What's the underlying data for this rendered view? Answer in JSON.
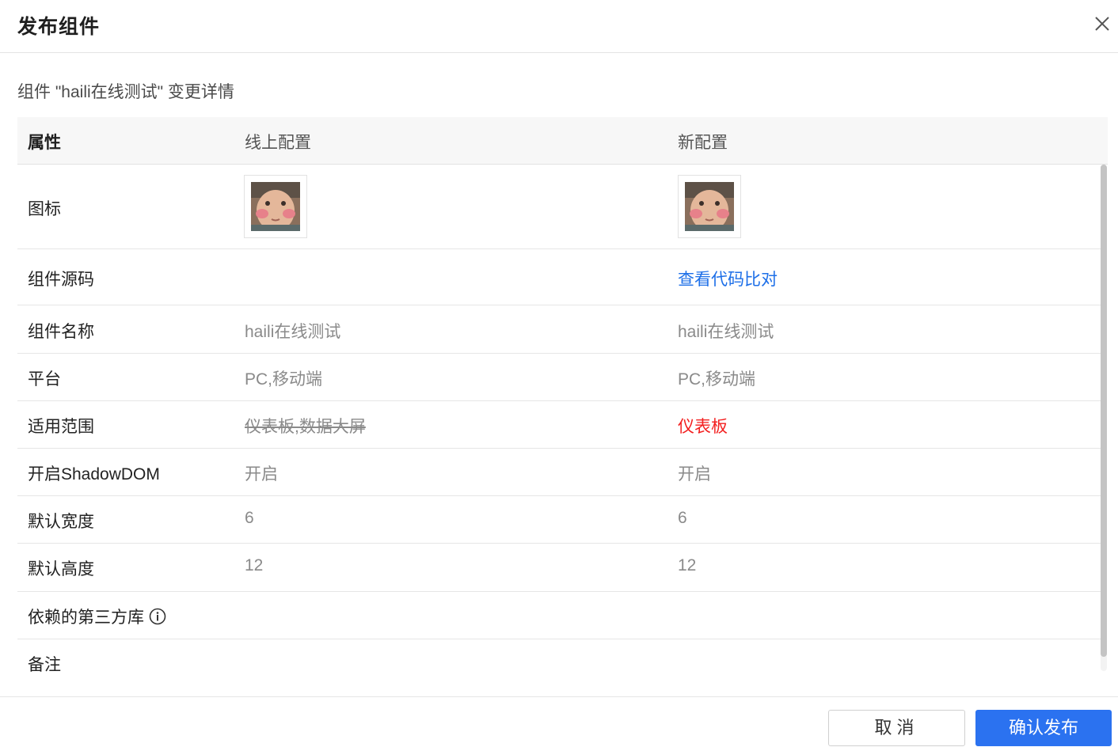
{
  "dialog": {
    "title": "发布组件",
    "subtitle": "组件 \"haili在线测试\" 变更详情"
  },
  "table": {
    "headers": {
      "attr": "属性",
      "online": "线上配置",
      "new": "新配置"
    },
    "rows": [
      {
        "attr": "图标",
        "online": "",
        "new": ""
      },
      {
        "attr": "组件源码",
        "online": "",
        "new": "查看代码比对"
      },
      {
        "attr": "组件名称",
        "online": "haili在线测试",
        "new": "haili在线测试"
      },
      {
        "attr": "平台",
        "online": "PC,移动端",
        "new": "PC,移动端"
      },
      {
        "attr": "适用范围",
        "online": "仪表板,数据大屏",
        "new": "仪表板"
      },
      {
        "attr": "开启ShadowDOM",
        "online": "开启",
        "new": "开启"
      },
      {
        "attr": "默认宽度",
        "online": "6",
        "new": "6"
      },
      {
        "attr": "默认高度",
        "online": "12",
        "new": "12"
      },
      {
        "attr": "依赖的第三方库",
        "online": "",
        "new": ""
      },
      {
        "attr": "备注",
        "online": "",
        "new": ""
      }
    ]
  },
  "footer": {
    "cancel_label": "取消",
    "confirm_label": "确认发布"
  },
  "colors": {
    "primary": "#2b72f0",
    "link": "#1d6fe8",
    "changed_new": "#f31f1f"
  },
  "icons": [
    "close-icon",
    "info-icon",
    "component-icon-image"
  ]
}
